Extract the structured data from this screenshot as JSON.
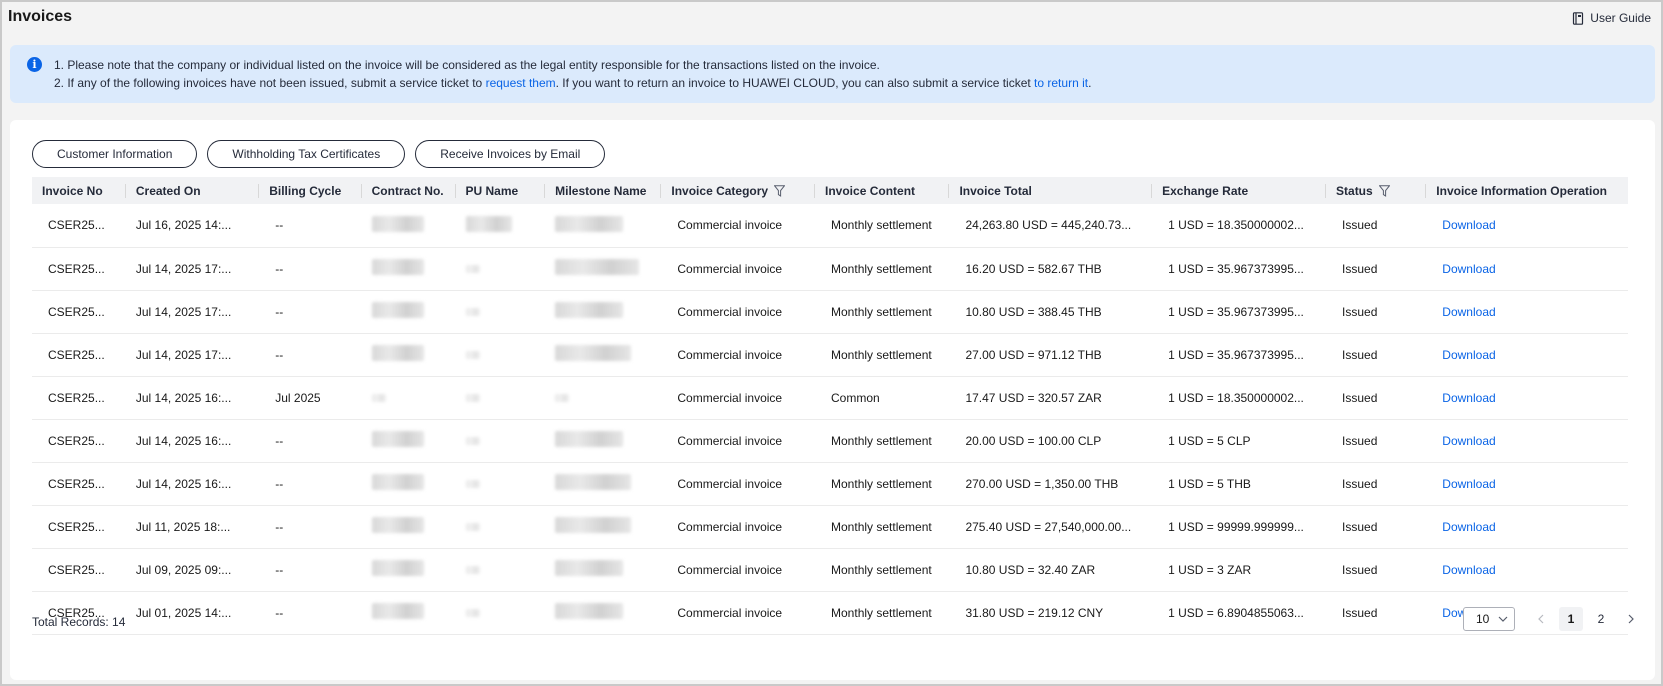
{
  "header": {
    "title": "Invoices",
    "user_guide": "User Guide"
  },
  "notice": {
    "line1": "1. Please note that the company or individual listed on the invoice will be considered as the legal entity responsible for the transactions listed on the invoice.",
    "line2_before": "2. If any of the following invoices have not been issued, submit a service ticket to ",
    "line2_link1": "request them",
    "line2_middle": ". If you want to return an invoice to HUAWEI CLOUD, you can also submit a service ticket ",
    "line2_link2": "to return it",
    "line2_after": "."
  },
  "actions": {
    "customer_info": "Customer Information",
    "withholding": "Withholding Tax Certificates",
    "receive_email": "Receive Invoices by Email"
  },
  "table": {
    "columns": [
      "Invoice No",
      "Created On",
      "Billing Cycle",
      "Contract No.",
      "PU Name",
      "Milestone Name",
      "Invoice Category",
      "Invoice Content",
      "Invoice Total",
      "Exchange Rate",
      "Status",
      "Invoice Information Operation"
    ],
    "rows": [
      {
        "invoice_no": "CSER25...",
        "created": "Jul 16, 2025 14:...",
        "cycle": "--",
        "category": "Commercial invoice",
        "content": "Monthly settlement",
        "total": "24,263.80 USD = 445,240.73...",
        "rate": "1 USD = 18.350000002...",
        "status": "Issued",
        "op": "Download"
      },
      {
        "invoice_no": "CSER25...",
        "created": "Jul 14, 2025 17:...",
        "cycle": "--",
        "category": "Commercial invoice",
        "content": "Monthly settlement",
        "total": "16.20 USD = 582.67 THB",
        "rate": "1 USD = 35.967373995...",
        "status": "Issued",
        "op": "Download"
      },
      {
        "invoice_no": "CSER25...",
        "created": "Jul 14, 2025 17:...",
        "cycle": "--",
        "category": "Commercial invoice",
        "content": "Monthly settlement",
        "total": "10.80 USD = 388.45 THB",
        "rate": "1 USD = 35.967373995...",
        "status": "Issued",
        "op": "Download"
      },
      {
        "invoice_no": "CSER25...",
        "created": "Jul 14, 2025 17:...",
        "cycle": "--",
        "category": "Commercial invoice",
        "content": "Monthly settlement",
        "total": "27.00 USD = 971.12 THB",
        "rate": "1 USD = 35.967373995...",
        "status": "Issued",
        "op": "Download"
      },
      {
        "invoice_no": "CSER25...",
        "created": "Jul 14, 2025 16:...",
        "cycle": "Jul 2025",
        "category": "Commercial invoice",
        "content": "Common",
        "total": "17.47 USD = 320.57 ZAR",
        "rate": "1 USD = 18.350000002...",
        "status": "Issued",
        "op": "Download"
      },
      {
        "invoice_no": "CSER25...",
        "created": "Jul 14, 2025 16:...",
        "cycle": "--",
        "category": "Commercial invoice",
        "content": "Monthly settlement",
        "total": "20.00 USD = 100.00 CLP",
        "rate": "1 USD = 5 CLP",
        "status": "Issued",
        "op": "Download"
      },
      {
        "invoice_no": "CSER25...",
        "created": "Jul 14, 2025 16:...",
        "cycle": "--",
        "category": "Commercial invoice",
        "content": "Monthly settlement",
        "total": "270.00 USD = 1,350.00 THB",
        "rate": "1 USD = 5 THB",
        "status": "Issued",
        "op": "Download"
      },
      {
        "invoice_no": "CSER25...",
        "created": "Jul 11, 2025 18:...",
        "cycle": "--",
        "category": "Commercial invoice",
        "content": "Monthly settlement",
        "total": "275.40 USD = 27,540,000.00...",
        "rate": "1 USD = 99999.999999...",
        "status": "Issued",
        "op": "Download"
      },
      {
        "invoice_no": "CSER25...",
        "created": "Jul 09, 2025 09:...",
        "cycle": "--",
        "category": "Commercial invoice",
        "content": "Monthly settlement",
        "total": "10.80 USD = 32.40 ZAR",
        "rate": "1 USD = 3 ZAR",
        "status": "Issued",
        "op": "Download"
      },
      {
        "invoice_no": "CSER25...",
        "created": "Jul 01, 2025 14:...",
        "cycle": "--",
        "category": "Commercial invoice",
        "content": "Monthly settlement",
        "total": "31.80 USD = 219.12 CNY",
        "rate": "1 USD = 6.8904855063...",
        "status": "Issued",
        "op": "Download"
      }
    ]
  },
  "footer": {
    "total_records": "Total Records: 14",
    "page_size": "10",
    "pages": [
      "1",
      "2"
    ],
    "current_page": "1"
  },
  "colors": {
    "link": "#0a64e6",
    "notice_bg": "#dbeafc",
    "header_bg": "#f1f2f4"
  }
}
